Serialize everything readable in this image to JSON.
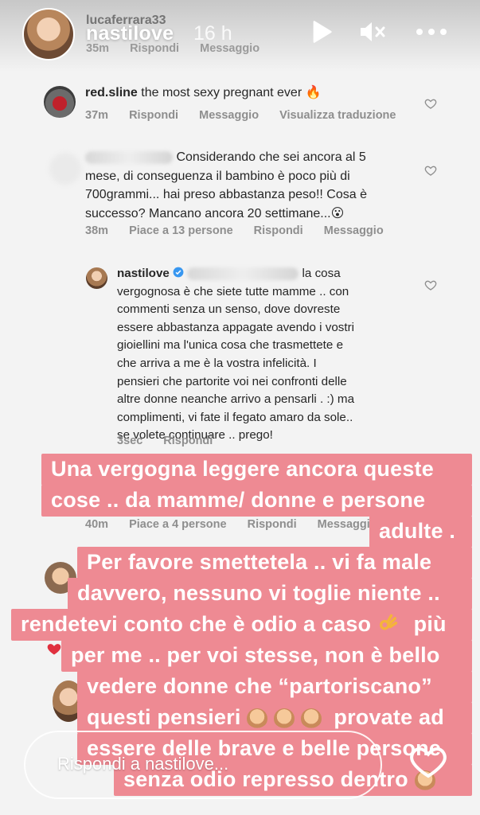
{
  "header": {
    "username": "nastilove",
    "time": "16 h"
  },
  "top_comment": {
    "username": "lucaferrara33",
    "time": "35m",
    "reply": "Rispondi",
    "message": "Messaggio"
  },
  "comments": [
    {
      "username": "red.sline",
      "text": "the most sexy pregnant ever 🔥",
      "time": "37m",
      "reply": "Rispondi",
      "message": "Messaggio",
      "translate": "Visualizza traduzione"
    },
    {
      "lines": [
        "Considerando che sei ancora al 5",
        "mese, di conseguenza il bambino è poco più di",
        "700grammi... hai preso abbastanza peso!! Cosa è",
        "successo? Mancano ancora 20 settimane...😮"
      ],
      "time": "38m",
      "likes": "Piace a 13 persone",
      "reply": "Rispondi",
      "message": "Messaggio"
    },
    {
      "username": "nastilove",
      "first_line_tail": "la cosa",
      "lines": [
        "vergognosa è che siete tutte mamme .. con",
        "commenti senza un senso, dove dovreste",
        "essere abbastanza appagate avendo i vostri",
        "gioiellini ma l'unica cosa che trasmettete e",
        "che arriva a me è la vostra infelicità. I",
        "pensieri che partorite voi nei confronti delle",
        "altre donne neanche arrivo a pensarli . :) ma",
        "complimenti, vi fate il fegato amaro da sole..",
        "se volete continuare .. prego!"
      ],
      "time": "3sec",
      "reply": "Rispondi"
    }
  ],
  "hidden_meta": {
    "time": "40m",
    "likes": "Piace a 4 persone",
    "reply": "Rispondi",
    "message": "Messaggio"
  },
  "overlay": {
    "lines": [
      "Una vergogna leggere ancora queste",
      "cose .. da mamme/ donne  e persone",
      "adulte .",
      "Per favore smettetela .. vi fa male",
      "davvero, nessuno vi toglie niente ..",
      "rendetevi conto che è odio a caso",
      "più",
      "per me .. per voi stesse, non è bello",
      "vedere donne che “partoriscano”",
      "questi pensieri",
      "provate ad",
      "essere delle brave e belle persone",
      "senza odio represso dentro"
    ],
    "color": "#ee8a93"
  },
  "reply_bar": {
    "placeholder": "Rispondi a nastilove..."
  },
  "icons": [
    "play-icon",
    "mute-icon",
    "more-icon",
    "heart-icon",
    "verified-badge-icon",
    "fire-emoji",
    "ok-hand-emoji",
    "pray-emoji"
  ]
}
